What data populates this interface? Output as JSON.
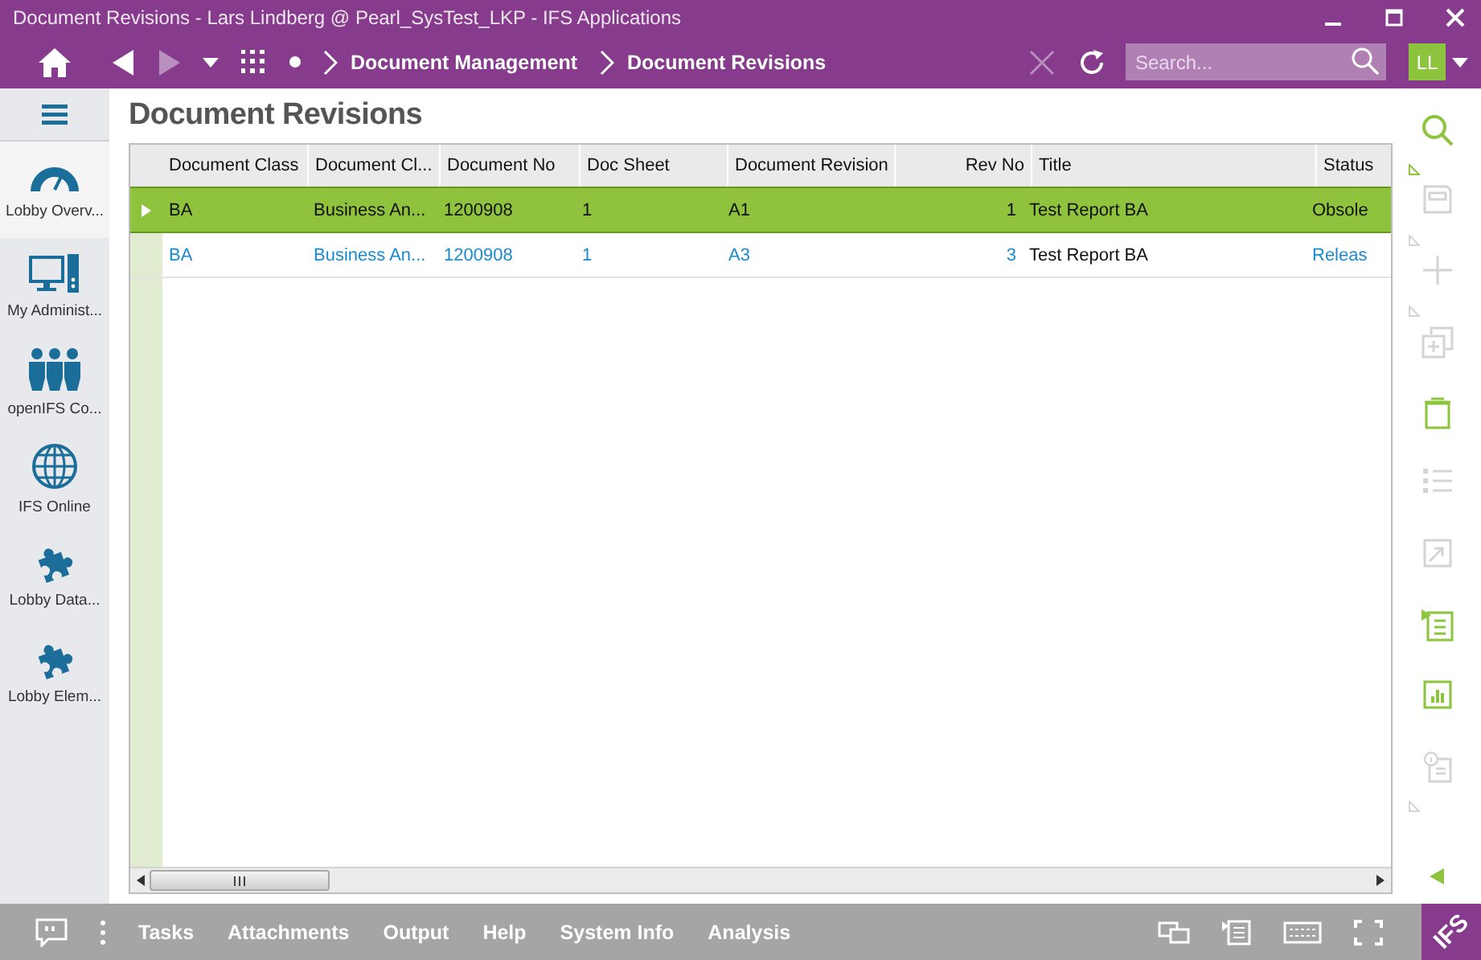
{
  "window": {
    "title": "Document Revisions - Lars Lindberg @ Pearl_SysTest_LKP - IFS Applications"
  },
  "nav": {
    "forward_disabled": true,
    "clear_disabled": true,
    "breadcrumbs": [
      "Document Management",
      "Document Revisions"
    ],
    "search": {
      "placeholder": "Search..."
    },
    "user_initials": "LL"
  },
  "sidebar": {
    "items": [
      {
        "label": "Lobby Overv...",
        "kind": "gauge",
        "selected": true
      },
      {
        "label": "My Administ...",
        "kind": "computer",
        "selected": false
      },
      {
        "label": "openIFS Co...",
        "kind": "people",
        "selected": false
      },
      {
        "label": "IFS Online",
        "kind": "globe",
        "selected": false
      },
      {
        "label": "Lobby Data...",
        "kind": "puzzle",
        "selected": false
      },
      {
        "label": "Lobby Elem...",
        "kind": "puzzle",
        "selected": false
      }
    ]
  },
  "page": {
    "title": "Document Revisions"
  },
  "table": {
    "columns": [
      {
        "label": "Document Class",
        "kind": "text",
        "linked": true
      },
      {
        "label": "Document Cl...",
        "kind": "text",
        "linked": true
      },
      {
        "label": "Document No",
        "kind": "text",
        "linked": true
      },
      {
        "label": "Doc Sheet",
        "kind": "text",
        "linked": true
      },
      {
        "label": "Document Revision",
        "kind": "text",
        "linked": true
      },
      {
        "label": "Rev No",
        "kind": "number",
        "linked": true
      },
      {
        "label": "Title",
        "kind": "text",
        "linked": false
      },
      {
        "label": "Status",
        "kind": "text",
        "linked": true
      }
    ],
    "rows": [
      {
        "selected": true,
        "cells": [
          "BA",
          "Business An...",
          "1200908",
          "1",
          "A1",
          "1",
          "Test Report BA",
          "Obsole"
        ]
      },
      {
        "selected": false,
        "cells": [
          "BA",
          "Business An...",
          "1200908",
          "1",
          "A3",
          "3",
          "Test Report BA",
          "Releas"
        ]
      }
    ]
  },
  "toolbar": [
    {
      "kind": "search",
      "disabled": false,
      "menu": true
    },
    {
      "kind": "save",
      "disabled": true,
      "menu": true
    },
    {
      "kind": "add",
      "disabled": true,
      "menu": true
    },
    {
      "kind": "duplicate",
      "disabled": true,
      "menu": false
    },
    {
      "kind": "delete",
      "disabled": false,
      "menu": false
    },
    {
      "kind": "list",
      "disabled": true,
      "menu": false
    },
    {
      "kind": "open",
      "disabled": true,
      "menu": false
    },
    {
      "kind": "details",
      "disabled": false,
      "menu": false
    },
    {
      "kind": "chart",
      "disabled": false,
      "menu": false
    },
    {
      "kind": "info",
      "disabled": true,
      "menu": true
    }
  ],
  "bottom_bar": {
    "items": [
      "Tasks",
      "Attachments",
      "Output",
      "Help",
      "System Info",
      "Analysis"
    ],
    "logo": "IFS"
  }
}
